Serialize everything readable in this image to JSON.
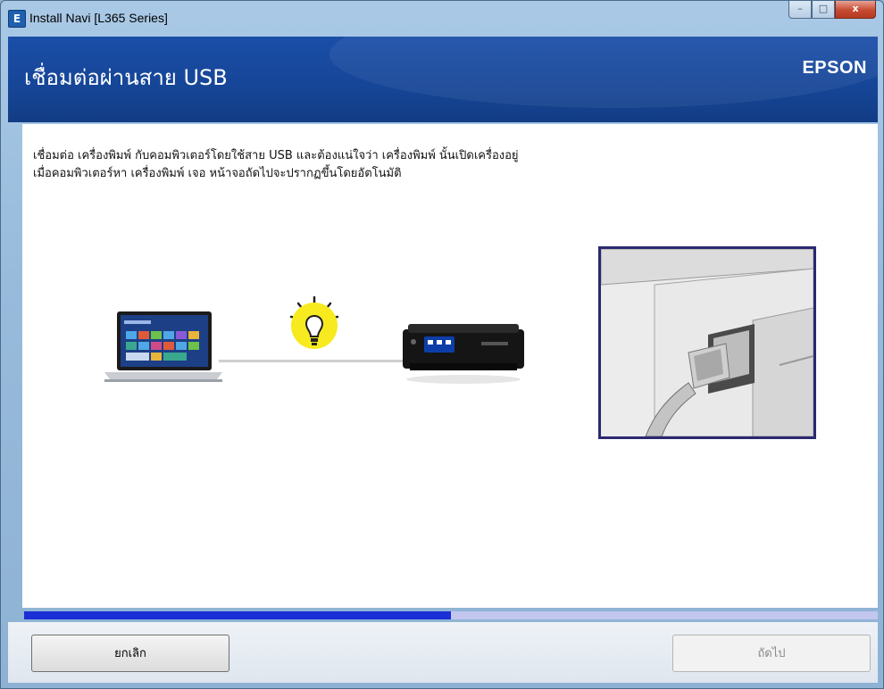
{
  "window": {
    "title": "Install Navi [L365 Series]",
    "app_icon_letter": "E"
  },
  "caption_buttons": {
    "minimize": "–",
    "maximize": "□",
    "close": "x"
  },
  "header": {
    "title": "เชื่อมต่อผ่านสาย USB",
    "brand": "EPSON"
  },
  "instruction": {
    "line1": "เชื่อมต่อ เครื่องพิมพ์ กับคอมพิวเตอร์โดยใช้สาย USB และต้องแน่ใจว่า เครื่องพิมพ์ นั้นเปิดเครื่องอยู่",
    "line2": "เมื่อคอมพิวเตอร์หา เครื่องพิมพ์ เจอ หน้าจอถัดไปจะปรากฏขึ้นโดยอัตโนมัติ"
  },
  "illustration": {
    "icons": [
      "laptop-icon",
      "lightbulb-icon",
      "printer-icon",
      "usb-cable-icon"
    ]
  },
  "progress": {
    "fraction": 0.5,
    "color": "#1a2fd6",
    "track_color": "#c3c6ee"
  },
  "footer": {
    "cancel_label": "ยกเลิก",
    "next_label": "ถัดไป"
  },
  "colors": {
    "header": "#164596",
    "photo_border": "#2b2970"
  }
}
